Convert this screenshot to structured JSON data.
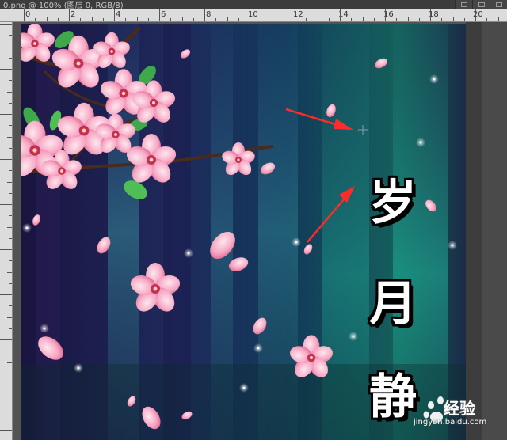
{
  "document": {
    "tab_title": "0.png @ 100% (图层 0, RGB/8)"
  },
  "ruler": {
    "labels": [
      "0",
      "2",
      "4",
      "6",
      "8",
      "10",
      "12",
      "14",
      "16",
      "18",
      "20"
    ]
  },
  "canvas": {
    "text_chars": [
      "岁",
      "月",
      "静"
    ]
  },
  "watermark": {
    "brand": "经验",
    "url": "jingyan.baidu.com"
  },
  "colors": {
    "ps_bg": "#535353",
    "arrow": "#ff2a2a",
    "blossom": "#f7a8c4"
  }
}
